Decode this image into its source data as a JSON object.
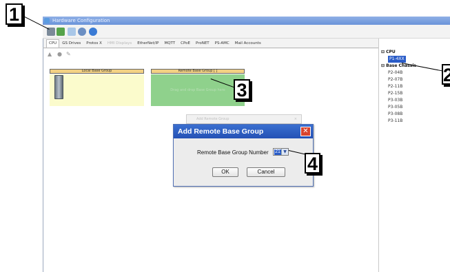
{
  "window": {
    "title": "Hardware Configuration"
  },
  "tabs": [
    {
      "label": "CPU",
      "state": "active"
    },
    {
      "label": "GS Drives",
      "state": "normal"
    },
    {
      "label": "Protos X",
      "state": "normal"
    },
    {
      "label": "HMI Displays",
      "state": "disabled"
    },
    {
      "label": "EtherNet/IP",
      "state": "normal"
    },
    {
      "label": "MQTT",
      "state": "normal"
    },
    {
      "label": "CPoE",
      "state": "normal"
    },
    {
      "label": "ProNET",
      "state": "normal"
    },
    {
      "label": "PS-AMC",
      "state": "normal"
    },
    {
      "label": "Mail Accounts",
      "state": "normal"
    }
  ],
  "canvas": {
    "local_group_label": "Local Base Group",
    "remote_group_label": "Remote Base Group [ ]",
    "remote_group_placeholder": "Drag and drop Base Group here"
  },
  "tree": {
    "cpu_header": "CPU",
    "cpu_items": [
      "P1-4XX"
    ],
    "chassis_header": "Base Chassis",
    "chassis_items": [
      "P2-04B",
      "P2-07B",
      "P2-11B",
      "P2-15B",
      "P3-03B",
      "P3-05B",
      "P3-08B",
      "P3-11B"
    ]
  },
  "ghost_dialog": {
    "title": "Add Remote Group"
  },
  "dialog": {
    "title": "Add Remote Base Group",
    "close_symbol": "✕",
    "field_label": "Remote Base Group Number",
    "field_value": "21",
    "ok_label": "OK",
    "cancel_label": "Cancel"
  },
  "callouts": {
    "c1": "1",
    "c2": "2",
    "c3": "3",
    "c4": "4"
  },
  "colors": {
    "group_header": "#f3d184",
    "local_group_bg": "#fbfbcc",
    "remote_group_bg": "#8fd18c",
    "dialog_title": "#2451b5",
    "selection": "#2a5cc8"
  }
}
